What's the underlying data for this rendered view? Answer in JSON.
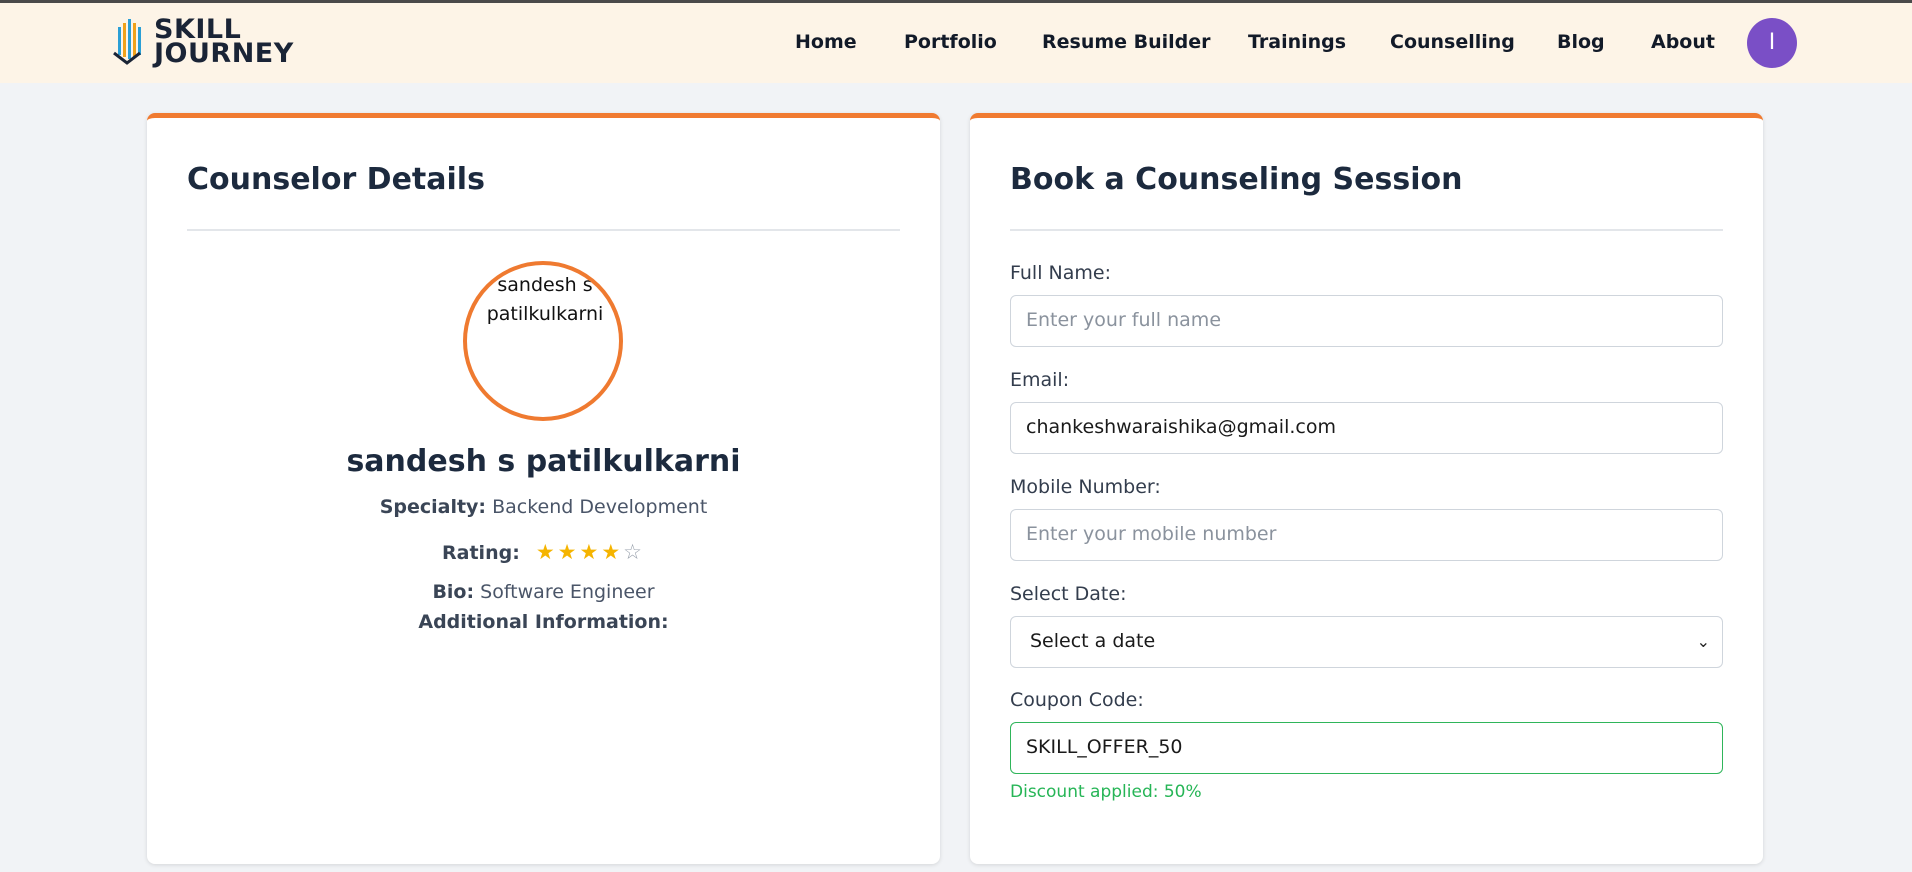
{
  "brand": {
    "line1": "SKILL",
    "line2": "JOURNEY"
  },
  "nav": {
    "items": [
      "Home",
      "Portfolio",
      "Resume Builder",
      "Trainings",
      "Counselling",
      "Blog",
      "About"
    ],
    "avatar_initial": "I",
    "avatar_color": "#7a4fc6"
  },
  "counselor": {
    "title": "Counselor Details",
    "photo_alt": "sandesh s patilkulkarni",
    "name": "sandesh s patilkulkarni",
    "specialty_label": "Specialty:",
    "specialty": "Backend Development",
    "rating_label": "Rating:",
    "rating": 4,
    "rating_max": 5,
    "bio_label": "Bio:",
    "bio": "Software Engineer",
    "additional_label": "Additional Information:"
  },
  "booking": {
    "title": "Book a Counseling Session",
    "full_name_label": "Full Name:",
    "full_name_placeholder": "Enter your full name",
    "email_label": "Email:",
    "email_value": "chankeshwaraishika@gmail.com",
    "mobile_label": "Mobile Number:",
    "mobile_placeholder": "Enter your mobile number",
    "date_label": "Select Date:",
    "date_value": "Select a date",
    "coupon_label": "Coupon Code:",
    "coupon_value": "SKILL_OFFER_50",
    "discount_message": "Discount applied: 50%"
  },
  "colors": {
    "accent": "#f07a30",
    "success": "#26b556",
    "star": "#f5b400",
    "navbar_bg": "#fdf4e7"
  }
}
